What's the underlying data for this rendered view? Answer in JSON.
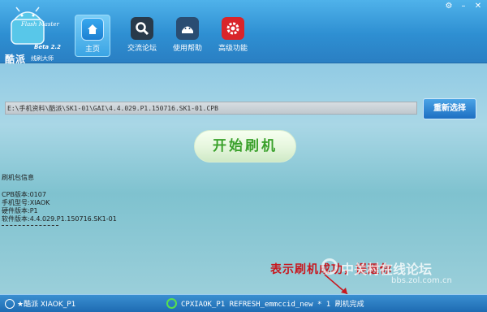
{
  "logo": {
    "flash_master": "Flash Master",
    "version": "Beta 2.2",
    "name": "酷派",
    "subtitle": "线刷大师"
  },
  "tabs": [
    {
      "label": "主页",
      "icon": "home-icon"
    },
    {
      "label": "交流论坛",
      "icon": "search-icon"
    },
    {
      "label": "使用帮助",
      "icon": "help-robot-icon"
    },
    {
      "label": "高级功能",
      "icon": "gear-icon"
    }
  ],
  "file_path": "E:\\手机资料\\酷派\\SK1-01\\GAI\\4.4.029.P1.150716.SK1-01.CPB",
  "reselect_label": "重新选择",
  "start_label": "开始刷机",
  "info": {
    "heading": "刷机包信息",
    "cpb_version": "CPB版本:0107",
    "phone_model": "手机型号:XIAOK",
    "hw_version": "硬件版本:P1",
    "sw_version": "软件版本:4.4.029.P1.150716.SK1-01"
  },
  "annotation": "表示刷机成功，提醒你",
  "watermark": {
    "main": "中关村在线论坛",
    "sub": "bbs.zol.com.cn"
  },
  "status": {
    "left": "★酷派 XIAOK_P1",
    "middle": "CPXIAOK_P1 REFRESH_emmccid_new * 1 刷机完成"
  },
  "colors": {
    "accent": "#2e8fd2",
    "start_text": "#3aa12b",
    "annotation": "#c8171e",
    "status_ok": "#57e04c"
  }
}
